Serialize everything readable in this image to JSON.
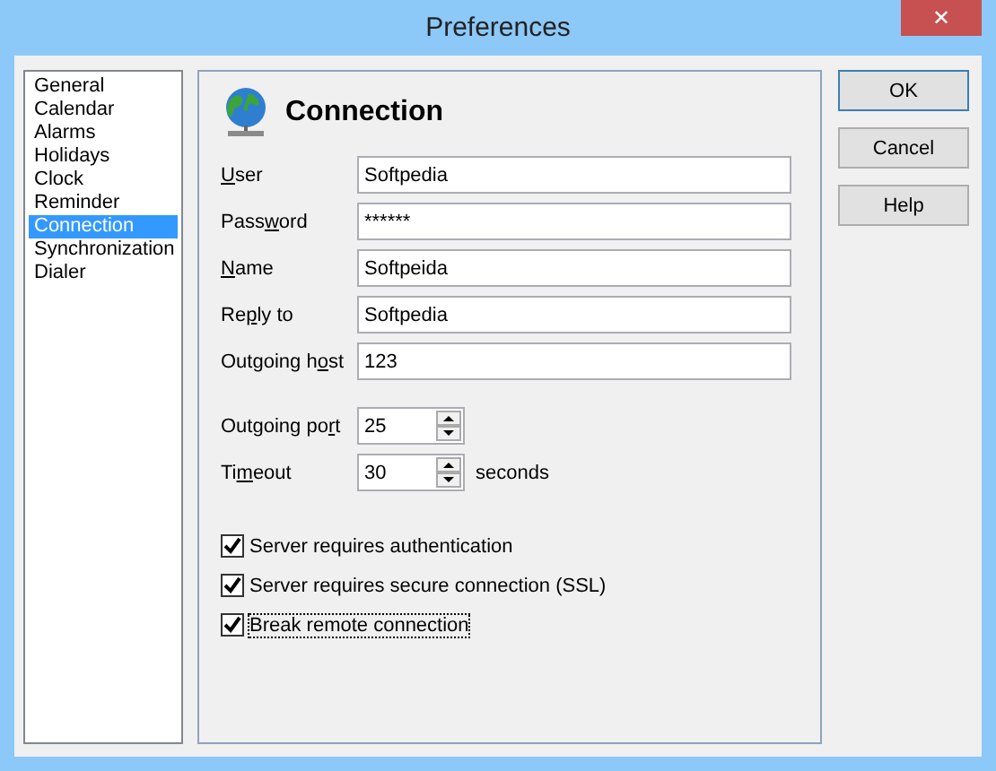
{
  "window": {
    "title": "Preferences",
    "close": "✕"
  },
  "sidebar": {
    "items": [
      {
        "label": "General",
        "selected": false
      },
      {
        "label": "Calendar",
        "selected": false
      },
      {
        "label": "Alarms",
        "selected": false
      },
      {
        "label": "Holidays",
        "selected": false
      },
      {
        "label": "Clock",
        "selected": false
      },
      {
        "label": "Reminder",
        "selected": false
      },
      {
        "label": "Connection",
        "selected": true
      },
      {
        "label": "Synchronization",
        "selected": false
      },
      {
        "label": "Dialer",
        "selected": false
      }
    ]
  },
  "panel": {
    "title": "Connection",
    "fields": [
      {
        "access_key": "U",
        "label_after": "ser",
        "value": "Softpedia"
      },
      {
        "label_before": "Pass",
        "access_key": "w",
        "label_after": "ord",
        "value": "******"
      },
      {
        "access_key": "N",
        "label_after": "ame",
        "value": "Softpeida"
      },
      {
        "label_before": "Re",
        "access_key": "p",
        "label_after": "ly to",
        "value": "Softpedia"
      },
      {
        "label_before": "Outgoing h",
        "access_key": "o",
        "label_after": "st",
        "value": "123"
      }
    ],
    "spinners": [
      {
        "label_before": "Outgoing po",
        "access_key": "r",
        "label_after": "t",
        "value": "25"
      },
      {
        "label_before": "Ti",
        "access_key": "m",
        "label_after": "eout",
        "value": "30",
        "unit": "seconds"
      }
    ],
    "checkboxes": [
      {
        "label": "Server requires authentication",
        "checked": true,
        "focused": false
      },
      {
        "label": "Server requires secure connection (SSL)",
        "checked": true,
        "focused": false
      },
      {
        "label": "Break remote connection",
        "checked": true,
        "focused": true
      }
    ]
  },
  "buttons": [
    {
      "label": "OK",
      "default": true
    },
    {
      "label": "Cancel",
      "default": false
    },
    {
      "label": "Help",
      "default": false
    }
  ]
}
